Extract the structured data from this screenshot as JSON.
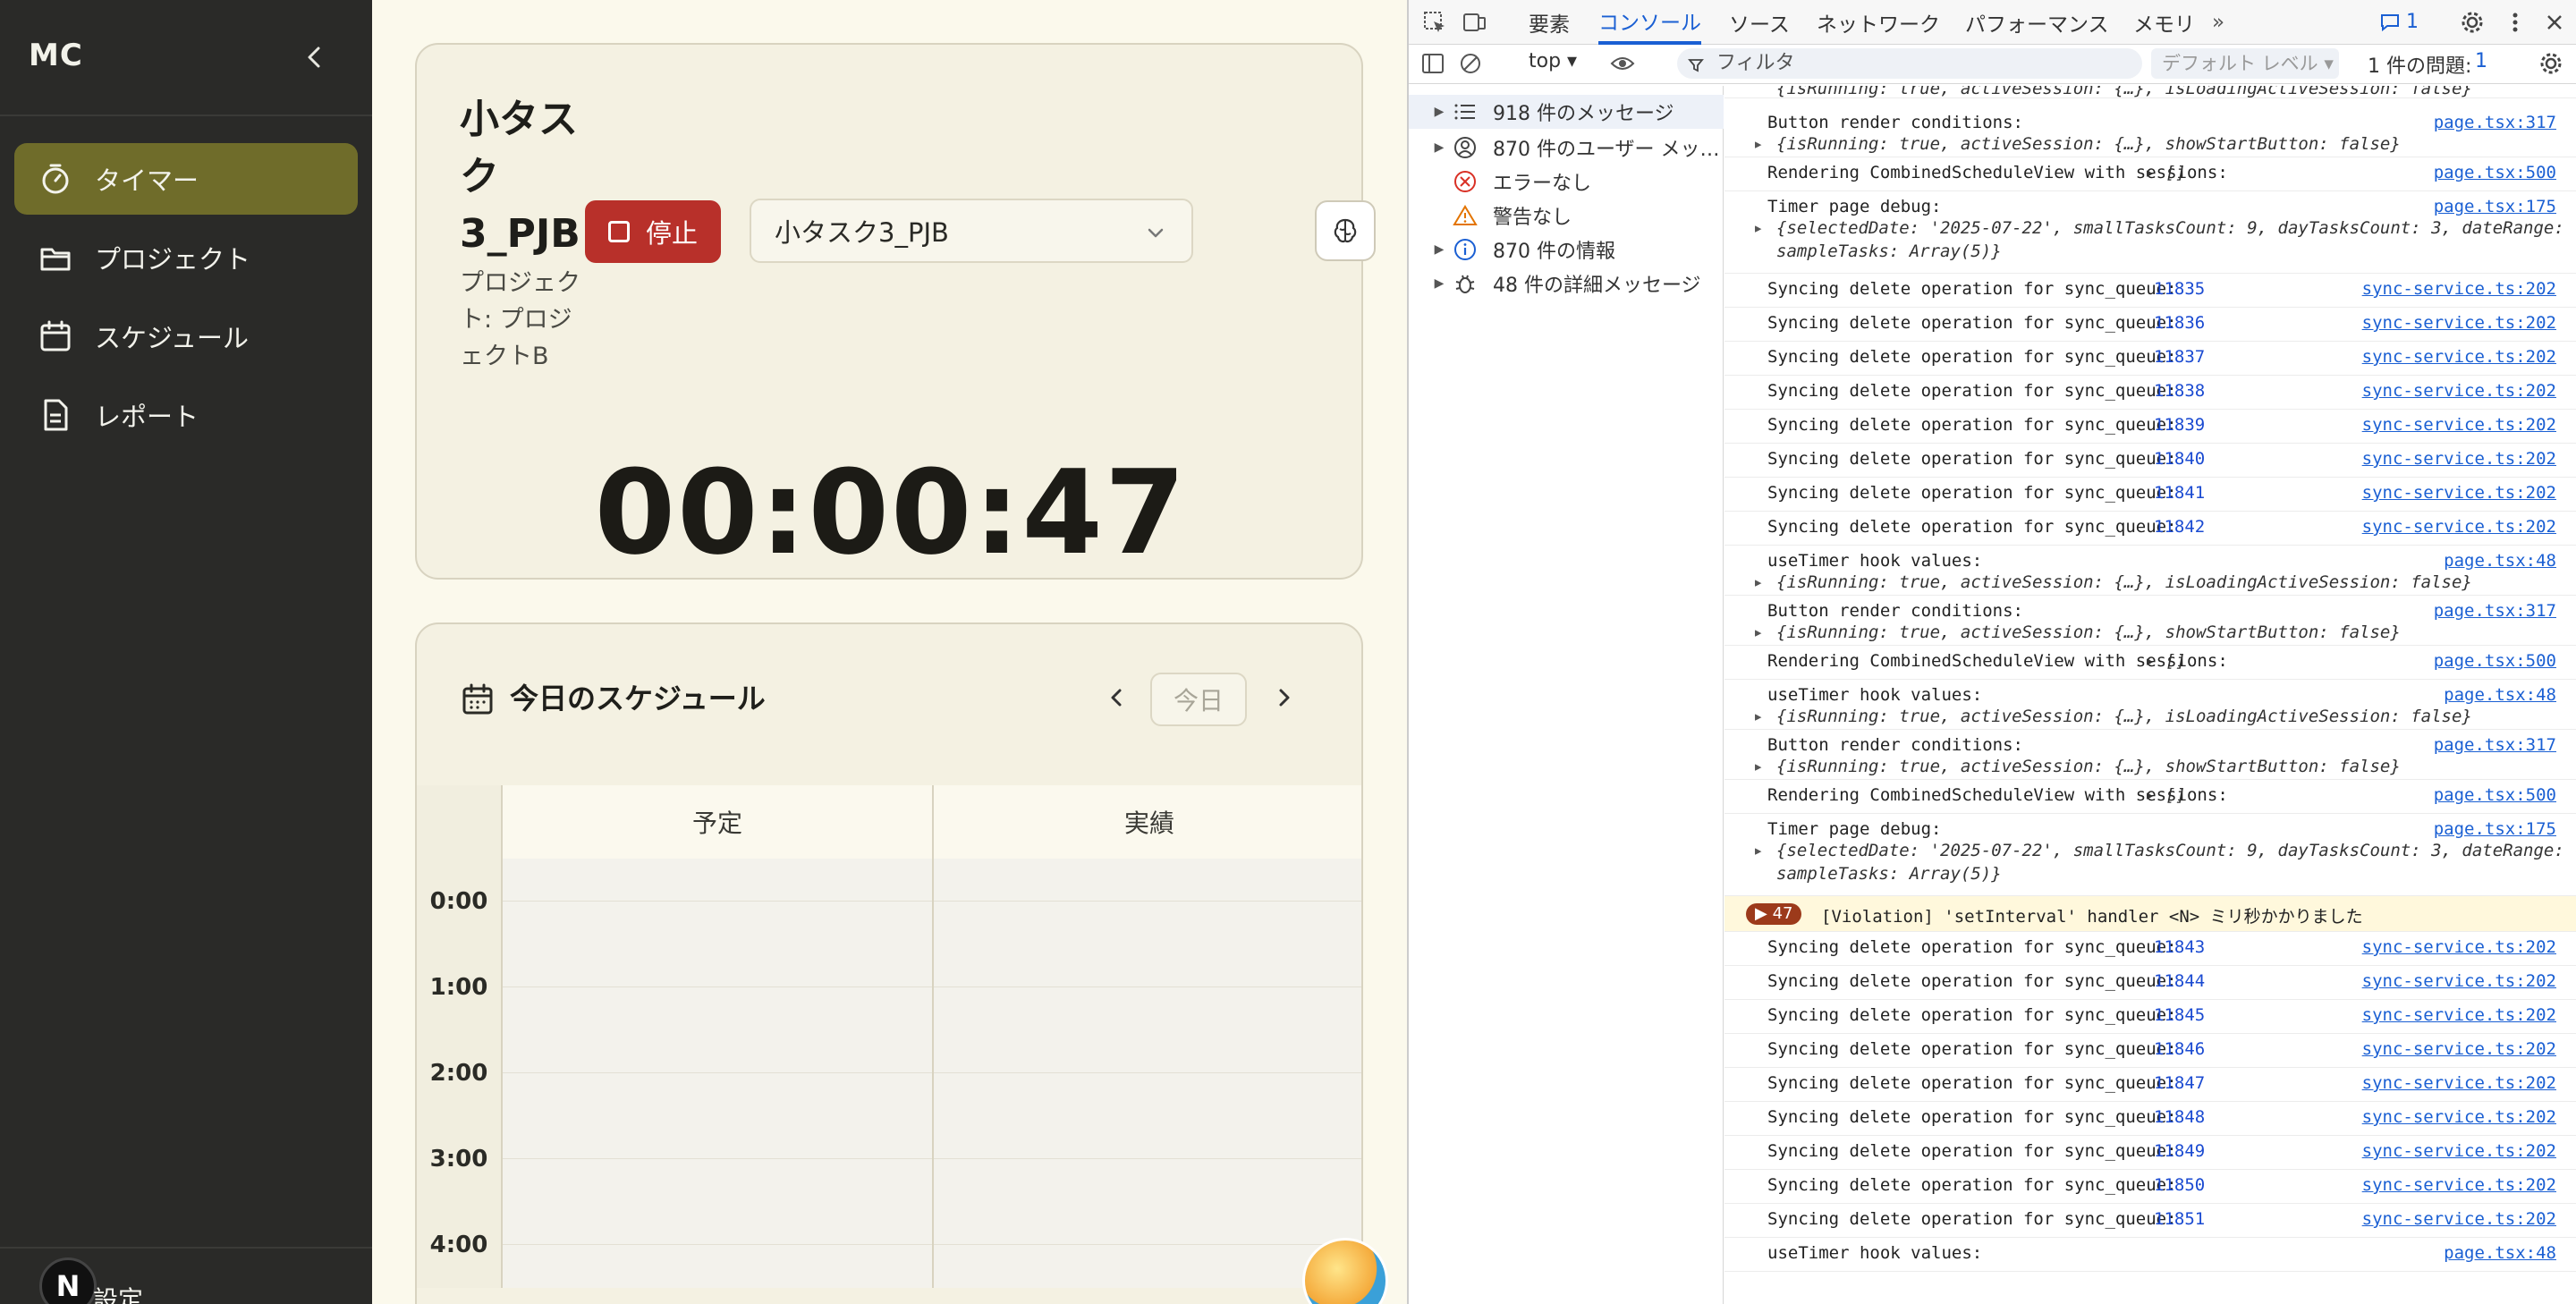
{
  "sidebar": {
    "brand": "MC",
    "items": [
      {
        "label": "タイマー",
        "icon": "stopwatch-icon",
        "active": true
      },
      {
        "label": "プロジェクト",
        "icon": "folder-icon",
        "active": false
      },
      {
        "label": "スケジュール",
        "icon": "calendar-icon",
        "active": false
      },
      {
        "label": "レポート",
        "icon": "document-icon",
        "active": false
      }
    ],
    "settings_label": "設定",
    "avatar_letter": "N"
  },
  "timer": {
    "task_title": "小タスク3_PJB",
    "project_label": "プロジェクト: プロジェクトB",
    "stop_label": "停止",
    "selected_task": "小タスク3_PJB",
    "elapsed": "00:00:47"
  },
  "schedule": {
    "title": "今日のスケジュール",
    "today_label": "今日",
    "col_plan": "予定",
    "col_actual": "実績",
    "hours": [
      "0:00",
      "1:00",
      "2:00",
      "3:00",
      "4:00"
    ]
  },
  "devtools": {
    "tabs": [
      "要素",
      "コンソール",
      "ソース",
      "ネットワーク",
      "パフォーマンス",
      "メモリ"
    ],
    "active_tab": "コンソール",
    "issue_badge": "1",
    "context": "top ▾",
    "filter_placeholder": "フィルタ",
    "level": "デフォルト レベル ▾",
    "issues": "1 件の問題:",
    "issues_count": "1",
    "side": [
      {
        "label": "918 件のメッセージ",
        "expand": true,
        "icon": "list-icon"
      },
      {
        "label": "870 件のユーザー メッ…",
        "expand": true,
        "icon": "user-icon"
      },
      {
        "label": "エラーなし",
        "expand": false,
        "icon": "error-icon"
      },
      {
        "label": "警告なし",
        "expand": false,
        "icon": "warning-icon"
      },
      {
        "label": "870 件の情報",
        "expand": true,
        "icon": "info-icon"
      },
      {
        "label": "48 件の詳細メッセージ",
        "expand": true,
        "icon": "bug-icon"
      }
    ],
    "top_obj": "{isRunning: true, activeSession: {…}, isLoadingActiveSession: false}",
    "logs_a": [
      {
        "msg": "Button render conditions:",
        "obj": "{isRunning: true, activeSession: {…}, showStartButton: false}",
        "src": "page.tsx:317"
      },
      {
        "msg": "Rendering CombinedScheduleView with sessions:",
        "inline": "▸ []",
        "src": "page.tsx:500"
      },
      {
        "msg": "Timer page debug:",
        "obj": "{selectedDate: '2025-07-22', smallTasksCount: 9, dayTasksCount: 3, dateRange: {…},",
        "obj2": "sampleTasks: Array(5)}",
        "src": "page.tsx:175"
      }
    ],
    "sync_prefix": "Syncing delete operation for sync_queue:",
    "sync_src": "sync-service.ts:202",
    "sync_ids_a": [
      "11835",
      "11836",
      "11837",
      "11838",
      "11839",
      "11840",
      "11841",
      "11842"
    ],
    "logs_b": [
      {
        "msg": "useTimer hook values:",
        "obj": "{isRunning: true, activeSession: {…}, isLoadingActiveSession: false}",
        "src": "page.tsx:48"
      },
      {
        "msg": "Button render conditions:",
        "obj": "{isRunning: true, activeSession: {…}, showStartButton: false}",
        "src": "page.tsx:317"
      },
      {
        "msg": "Rendering CombinedScheduleView with sessions:",
        "inline": "▸ []",
        "src": "page.tsx:500"
      },
      {
        "msg": "useTimer hook values:",
        "obj": "{isRunning: true, activeSession: {…}, isLoadingActiveSession: false}",
        "src": "page.tsx:48"
      },
      {
        "msg": "Button render conditions:",
        "obj": "{isRunning: true, activeSession: {…}, showStartButton: false}",
        "src": "page.tsx:317"
      },
      {
        "msg": "Rendering CombinedScheduleView with sessions:",
        "inline": "▸ []",
        "src": "page.tsx:500"
      },
      {
        "msg": "Timer page debug:",
        "obj": "{selectedDate: '2025-07-22', smallTasksCount: 9, dayTasksCount: 3, dateRange: {…},",
        "obj2": "sampleTasks: Array(5)}",
        "src": "page.tsx:175"
      }
    ],
    "violation_count": "▶ 47",
    "violation_text": "[Violation] 'setInterval' handler <N> ミリ秒かかりました",
    "sync_ids_b": [
      "11843",
      "11844",
      "11845",
      "11846",
      "11847",
      "11848",
      "11849",
      "11850",
      "11851"
    ],
    "last_log": {
      "msg": "useTimer hook values:",
      "src": "page.tsx:48"
    }
  }
}
